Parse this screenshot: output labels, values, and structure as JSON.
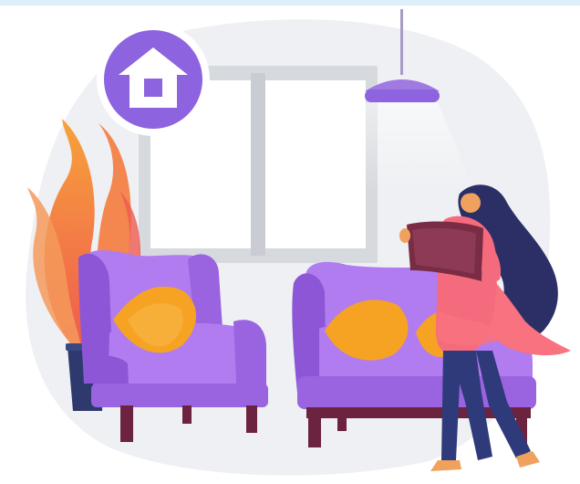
{
  "illustration": {
    "subject": "smart-home-living-room",
    "icons": [
      "home-icon"
    ],
    "colors": {
      "top_bar": "#dbeefa",
      "backdrop": "#eef0f3",
      "window_frame": "#d6d9de",
      "window_glass": "#ffffff",
      "lamp": "#a07ae0",
      "home_badge": "#8e63df",
      "sofa": "#b07cf0",
      "sofa_dark": "#8d56d6",
      "pillow": "#f6a323",
      "furniture_legs": "#6b2340",
      "plant": "#f47a3e",
      "pot": "#2e3a6e",
      "woman_top": "#f56b7e",
      "woman_pants": "#2f3a7a",
      "woman_hair": "#2b2f66",
      "tablet": "#7a2c44",
      "scarf": "#f8727f"
    }
  }
}
